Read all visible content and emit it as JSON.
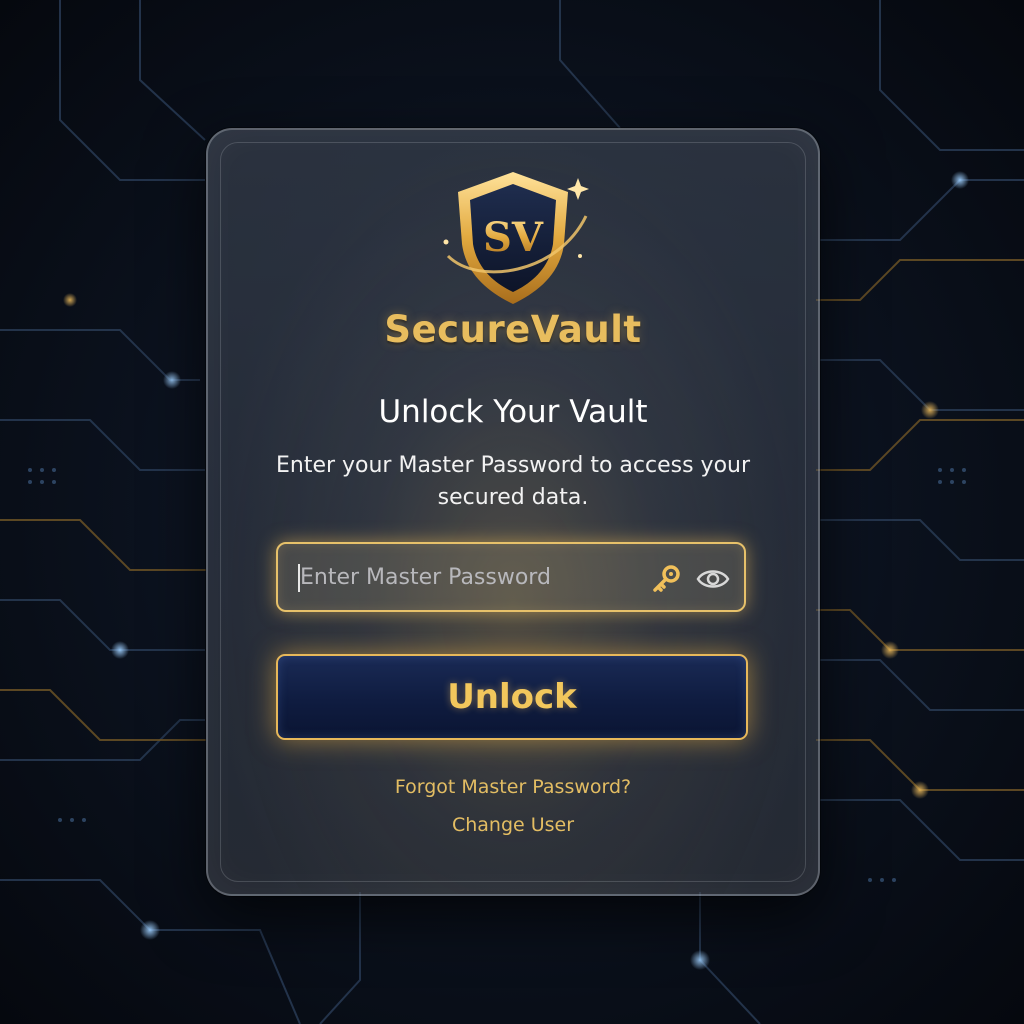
{
  "app": {
    "brand_name": "SecureVault",
    "logo_monogram": "SV",
    "logo_icon": "shield-icon"
  },
  "unlock": {
    "title": "Unlock Your Vault",
    "subtitle": "Enter your Master Password to access your secured data.",
    "password_placeholder": "Enter Master Password",
    "password_value": "",
    "key_icon": "key-icon",
    "show_password_icon": "eye-icon",
    "unlock_label": "Unlock",
    "forgot_label": "Forgot Master Password?",
    "change_user_label": "Change User"
  },
  "colors": {
    "accent_gold": "#e8bd5e",
    "button_navy": "#13224a",
    "background": "#070b12"
  }
}
